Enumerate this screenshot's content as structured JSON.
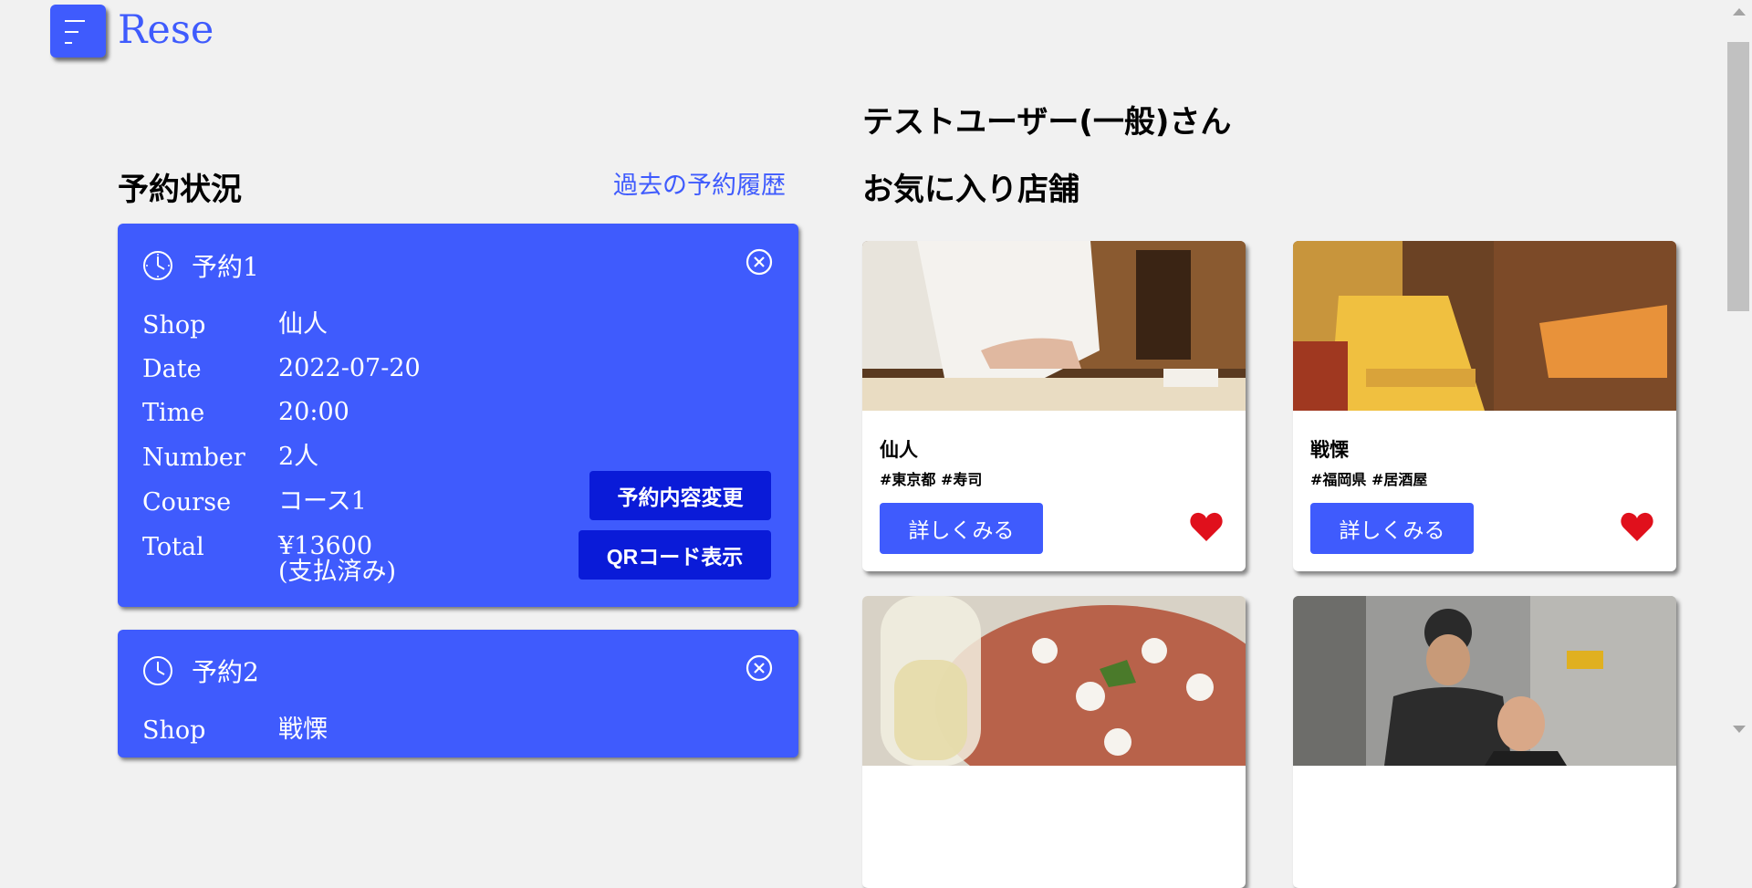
{
  "app": {
    "logo": "Rese"
  },
  "user": {
    "greeting": "テストユーザー(一般)さん"
  },
  "reservations": {
    "title": "予約状況",
    "history_link": "過去の予約履歴",
    "labels": {
      "shop": "Shop",
      "date": "Date",
      "time": "Time",
      "number": "Number",
      "course": "Course",
      "total": "Total"
    },
    "items": [
      {
        "title": "予約1",
        "shop": "仙人",
        "date": "2022-07-20",
        "time": "20:00",
        "number": "2人",
        "course": "コース1",
        "total": "¥13600",
        "status": "(支払済み)",
        "change_button": "予約内容変更",
        "qr_button": "QRコード表示"
      },
      {
        "title": "予約2",
        "shop": "戦慄"
      }
    ]
  },
  "favorites": {
    "title": "お気に入り店舗",
    "detail_label": "詳しくみる",
    "shops": [
      {
        "name": "仙人",
        "tags": "#東京都  #寿司"
      },
      {
        "name": "戦慄",
        "tags": "#福岡県  #居酒屋"
      },
      {
        "name": "",
        "tags": ""
      },
      {
        "name": "",
        "tags": ""
      }
    ]
  },
  "colors": {
    "accent": "#3f5bfd",
    "dark_button": "#0a1bd8",
    "heart": "#e0101c",
    "background": "#f1f1f1"
  }
}
